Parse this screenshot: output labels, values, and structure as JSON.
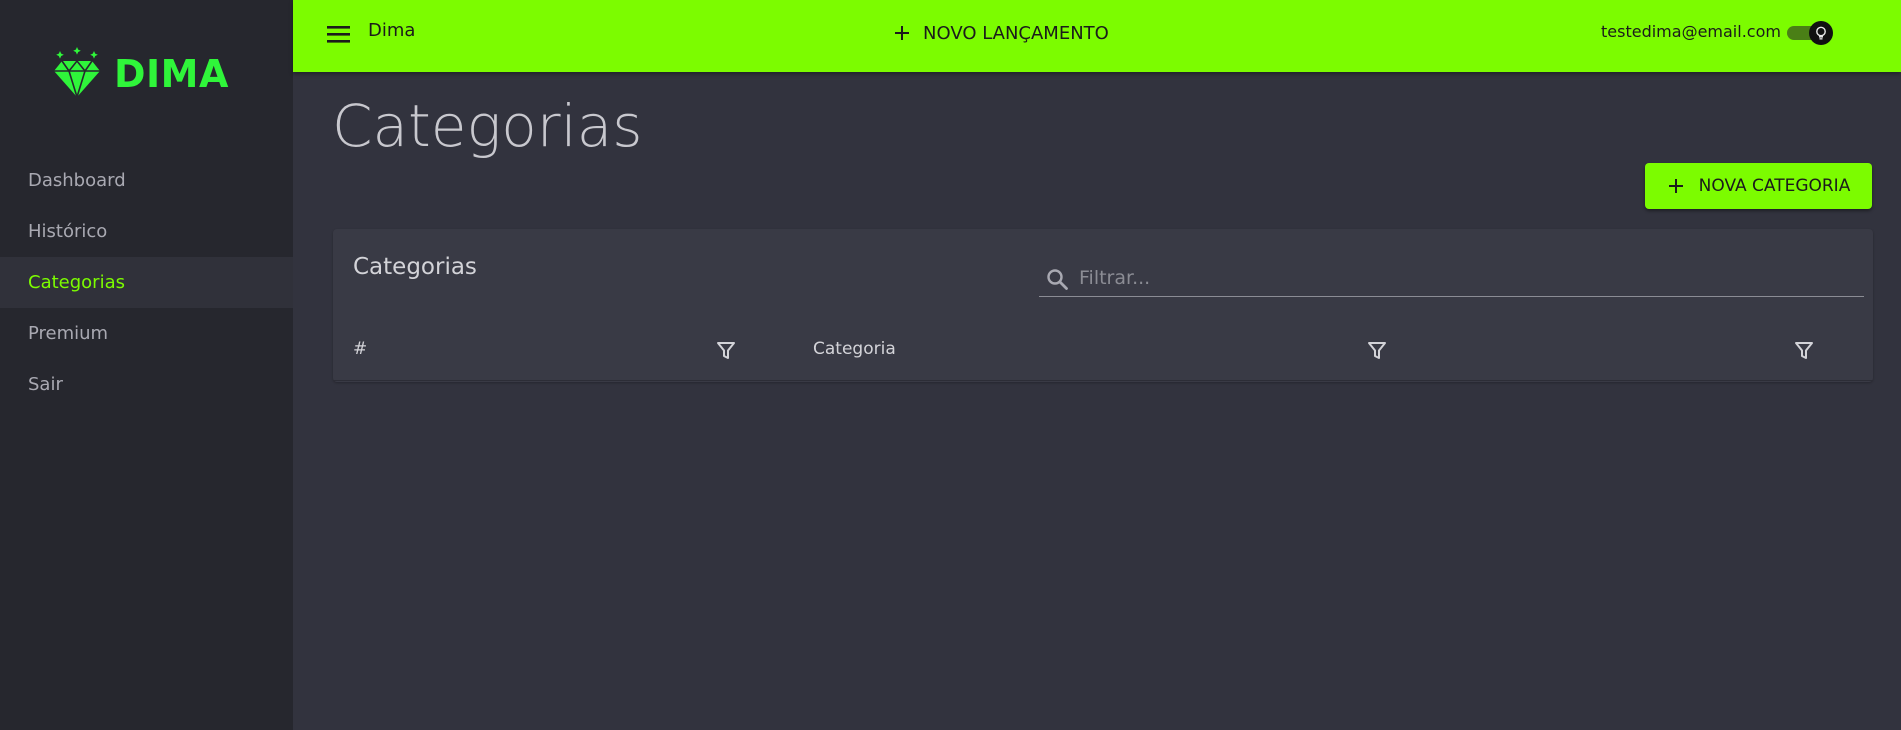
{
  "sidebar": {
    "logo_text": "DIMA",
    "items": [
      {
        "label": "Dashboard",
        "active": false
      },
      {
        "label": "Histórico",
        "active": false
      },
      {
        "label": "Categorias",
        "active": true
      },
      {
        "label": "Premium",
        "active": false
      },
      {
        "label": "Sair",
        "active": false
      }
    ]
  },
  "topbar": {
    "app_name": "Dima",
    "new_launch_label": "NOVO LANÇAMENTO",
    "user_email": "testedima@email.com"
  },
  "main": {
    "page_title": "Categorias",
    "new_category_label": "NOVA CATEGORIA",
    "card": {
      "title": "Categorias",
      "search_placeholder": "Filtrar...",
      "columns": [
        "#",
        "Categoria",
        ""
      ]
    }
  },
  "colors": {
    "accent": "#7cfc00",
    "logo": "#2ff53a",
    "sidebar_bg": "#26272e",
    "page_bg": "#32333e",
    "card_bg": "#393a45"
  }
}
